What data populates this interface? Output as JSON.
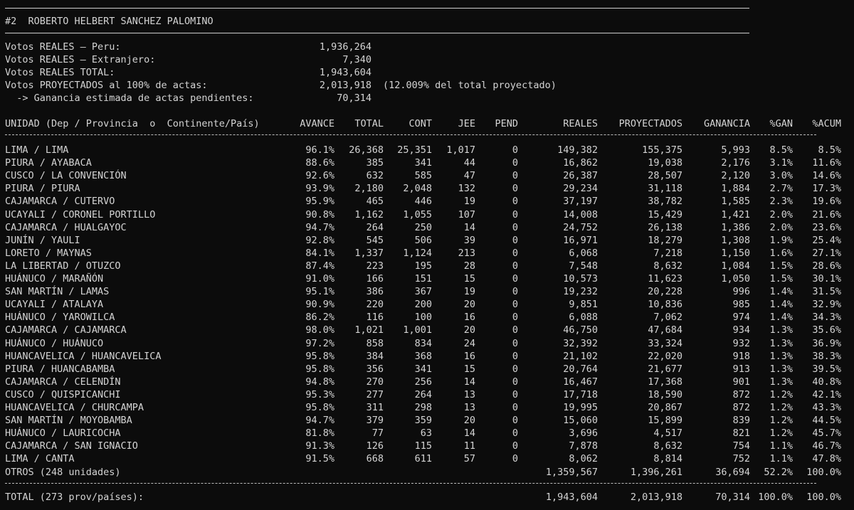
{
  "header": {
    "title": "#2  ROBERTO HELBERT SANCHEZ PALOMINO"
  },
  "summary": [
    {
      "label": "Votos REALES — Peru:",
      "value": "1,936,264",
      "note": ""
    },
    {
      "label": "Votos REALES — Extranjero:",
      "value": "7,340",
      "note": ""
    },
    {
      "label": "Votos REALES TOTAL:",
      "value": "1,943,604",
      "note": ""
    },
    {
      "label": "Votos PROYECTADOS al 100% de actas:",
      "value": "2,013,918",
      "note": "(12.009% del total proyectado)"
    },
    {
      "label": "  -> Ganancia estimada de actas pendientes:",
      "value": "70,314",
      "note": ""
    }
  ],
  "table": {
    "headers": [
      "UNIDAD (Dep / Provincia  o  Continente/País)",
      "AVANCE",
      "TOTAL",
      "CONT",
      "JEE",
      "PEND",
      "REALES",
      "PROYECTADOS",
      "GANANCIA",
      "%GAN",
      "%ACUM"
    ],
    "rows": [
      [
        "LIMA / LIMA",
        "96.1%",
        "26,368",
        "25,351",
        "1,017",
        "0",
        "149,382",
        "155,375",
        "5,993",
        "8.5%",
        "8.5%"
      ],
      [
        "PIURA / AYABACA",
        "88.6%",
        "385",
        "341",
        "44",
        "0",
        "16,862",
        "19,038",
        "2,176",
        "3.1%",
        "11.6%"
      ],
      [
        "CUSCO / LA CONVENCIÓN",
        "92.6%",
        "632",
        "585",
        "47",
        "0",
        "26,387",
        "28,507",
        "2,120",
        "3.0%",
        "14.6%"
      ],
      [
        "PIURA / PIURA",
        "93.9%",
        "2,180",
        "2,048",
        "132",
        "0",
        "29,234",
        "31,118",
        "1,884",
        "2.7%",
        "17.3%"
      ],
      [
        "CAJAMARCA / CUTERVO",
        "95.9%",
        "465",
        "446",
        "19",
        "0",
        "37,197",
        "38,782",
        "1,585",
        "2.3%",
        "19.6%"
      ],
      [
        "UCAYALI / CORONEL PORTILLO",
        "90.8%",
        "1,162",
        "1,055",
        "107",
        "0",
        "14,008",
        "15,429",
        "1,421",
        "2.0%",
        "21.6%"
      ],
      [
        "CAJAMARCA / HUALGAYOC",
        "94.7%",
        "264",
        "250",
        "14",
        "0",
        "24,752",
        "26,138",
        "1,386",
        "2.0%",
        "23.6%"
      ],
      [
        "JUNÍN / YAULI",
        "92.8%",
        "545",
        "506",
        "39",
        "0",
        "16,971",
        "18,279",
        "1,308",
        "1.9%",
        "25.4%"
      ],
      [
        "LORETO / MAYNAS",
        "84.1%",
        "1,337",
        "1,124",
        "213",
        "0",
        "6,068",
        "7,218",
        "1,150",
        "1.6%",
        "27.1%"
      ],
      [
        "LA LIBERTAD / OTUZCO",
        "87.4%",
        "223",
        "195",
        "28",
        "0",
        "7,548",
        "8,632",
        "1,084",
        "1.5%",
        "28.6%"
      ],
      [
        "HUÁNUCO / MARAÑÓN",
        "91.0%",
        "166",
        "151",
        "15",
        "0",
        "10,573",
        "11,623",
        "1,050",
        "1.5%",
        "30.1%"
      ],
      [
        "SAN MARTÍN / LAMAS",
        "95.1%",
        "386",
        "367",
        "19",
        "0",
        "19,232",
        "20,228",
        "996",
        "1.4%",
        "31.5%"
      ],
      [
        "UCAYALI / ATALAYA",
        "90.9%",
        "220",
        "200",
        "20",
        "0",
        "9,851",
        "10,836",
        "985",
        "1.4%",
        "32.9%"
      ],
      [
        "HUÁNUCO / YAROWILCA",
        "86.2%",
        "116",
        "100",
        "16",
        "0",
        "6,088",
        "7,062",
        "974",
        "1.4%",
        "34.3%"
      ],
      [
        "CAJAMARCA / CAJAMARCA",
        "98.0%",
        "1,021",
        "1,001",
        "20",
        "0",
        "46,750",
        "47,684",
        "934",
        "1.3%",
        "35.6%"
      ],
      [
        "HUÁNUCO / HUÁNUCO",
        "97.2%",
        "858",
        "834",
        "24",
        "0",
        "32,392",
        "33,324",
        "932",
        "1.3%",
        "36.9%"
      ],
      [
        "HUANCAVELICA / HUANCAVELICA",
        "95.8%",
        "384",
        "368",
        "16",
        "0",
        "21,102",
        "22,020",
        "918",
        "1.3%",
        "38.3%"
      ],
      [
        "PIURA / HUANCABAMBA",
        "95.8%",
        "356",
        "341",
        "15",
        "0",
        "20,764",
        "21,677",
        "913",
        "1.3%",
        "39.5%"
      ],
      [
        "CAJAMARCA / CELENDÍN",
        "94.8%",
        "270",
        "256",
        "14",
        "0",
        "16,467",
        "17,368",
        "901",
        "1.3%",
        "40.8%"
      ],
      [
        "CUSCO / QUISPICANCHI",
        "95.3%",
        "277",
        "264",
        "13",
        "0",
        "17,718",
        "18,590",
        "872",
        "1.2%",
        "42.1%"
      ],
      [
        "HUANCAVELICA / CHURCAMPA",
        "95.8%",
        "311",
        "298",
        "13",
        "0",
        "19,995",
        "20,867",
        "872",
        "1.2%",
        "43.3%"
      ],
      [
        "SAN MARTÍN / MOYOBAMBA",
        "94.7%",
        "379",
        "359",
        "20",
        "0",
        "15,060",
        "15,899",
        "839",
        "1.2%",
        "44.5%"
      ],
      [
        "HUÁNUCO / LAURICOCHA",
        "81.8%",
        "77",
        "63",
        "14",
        "0",
        "3,696",
        "4,517",
        "821",
        "1.2%",
        "45.7%"
      ],
      [
        "CAJAMARCA / SAN IGNACIO",
        "91.3%",
        "126",
        "115",
        "11",
        "0",
        "7,878",
        "8,632",
        "754",
        "1.1%",
        "46.7%"
      ],
      [
        "LIMA / CANTA",
        "91.5%",
        "668",
        "611",
        "57",
        "0",
        "8,062",
        "8,814",
        "752",
        "1.1%",
        "47.8%"
      ],
      [
        "OTROS (248 unidades)",
        "",
        "",
        "",
        "",
        "",
        "1,359,567",
        "1,396,261",
        "36,694",
        "52.2%",
        "100.0%"
      ]
    ],
    "total": [
      "TOTAL (273 prov/países):",
      "",
      "",
      "",
      "",
      "",
      "1,943,604",
      "2,013,918",
      "70,314",
      "100.0%",
      "100.0%"
    ]
  }
}
